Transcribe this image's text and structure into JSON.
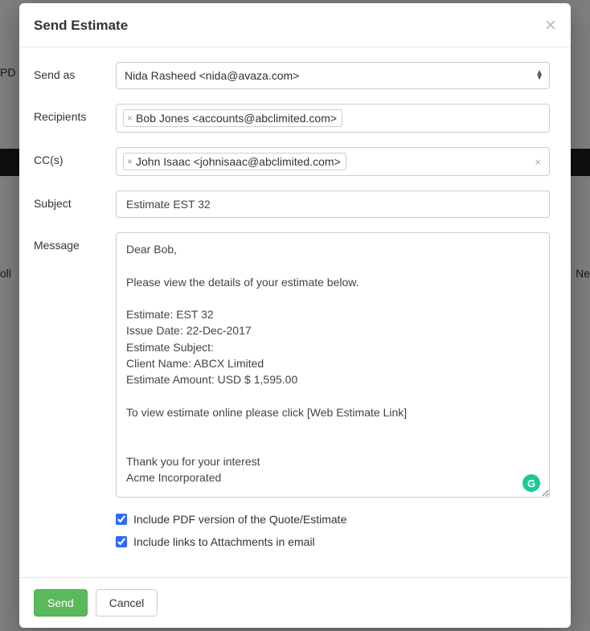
{
  "bg": {
    "pd": "PD",
    "oll": "oll",
    "net": "Ne"
  },
  "modal": {
    "title": "Send Estimate",
    "labels": {
      "send_as": "Send as",
      "recipients": "Recipients",
      "ccs": "CC(s)",
      "subject": "Subject",
      "message": "Message"
    },
    "send_as": {
      "selected": "Nida Rasheed <nida@avaza.com>"
    },
    "recipients": [
      {
        "label": "Bob Jones <accounts@abclimited.com>"
      }
    ],
    "ccs": [
      {
        "label": "John Isaac <johnisaac@abclimited.com>"
      }
    ],
    "subject_value": "Estimate EST 32",
    "message_value": "Dear Bob,\n\nPlease view the details of your estimate below.\n\nEstimate: EST 32\nIssue Date: 22-Dec-2017\nEstimate Subject:\nClient Name: ABCX Limited\nEstimate Amount: USD $ 1,595.00\n\nTo view estimate online please click [Web Estimate Link]\n\n\nThank you for your interest\nAcme Incorporated",
    "include_pdf_label": "Include PDF version of the Quote/Estimate",
    "include_links_label": "Include links to Attachments in email",
    "include_pdf_checked": true,
    "include_links_checked": true,
    "buttons": {
      "send": "Send",
      "cancel": "Cancel"
    },
    "grammar_badge": "G"
  }
}
